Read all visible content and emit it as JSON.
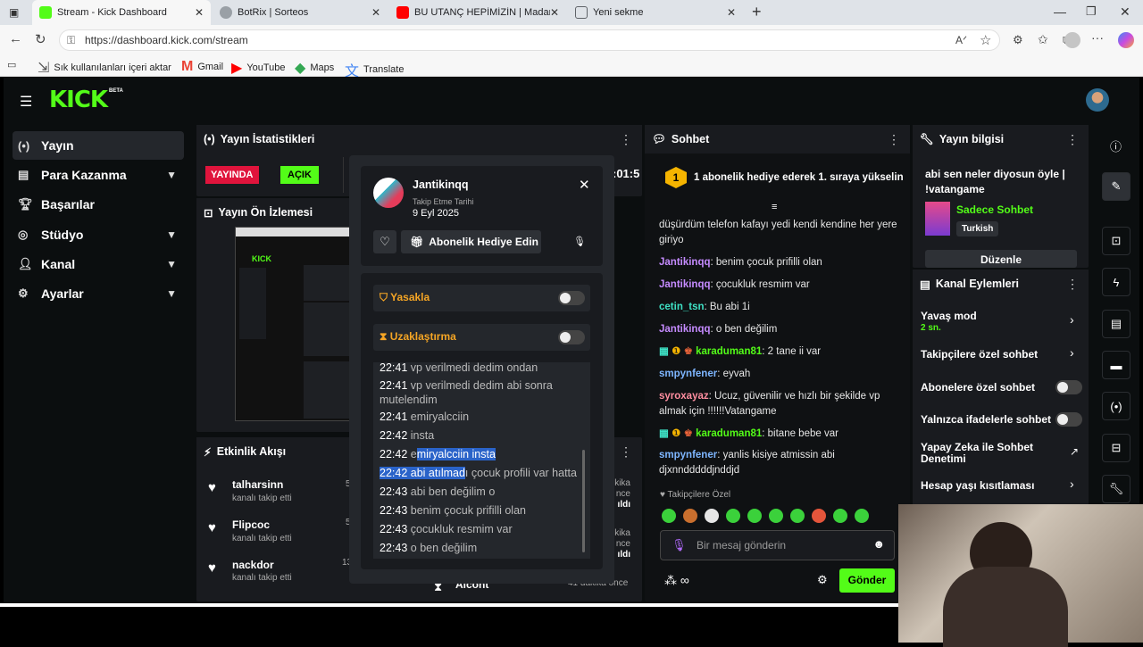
{
  "browser": {
    "tabs": [
      {
        "title": "Stream - Kick Dashboard",
        "favicon_color": "#53fc18"
      },
      {
        "title": "BotRix | Sorteos",
        "favicon_color": "#9aa0a6"
      },
      {
        "title": "BU UTANÇ HEPİMİZİN | Madara C",
        "favicon_color": "#ff0000"
      },
      {
        "title": "Yeni sekme",
        "favicon_color": "#5f6368"
      }
    ],
    "url": "https://dashboard.kick.com/stream",
    "bookmarks": [
      "Sık kullanılanları içeri aktar",
      "Gmail",
      "YouTube",
      "Maps",
      "Translate"
    ]
  },
  "brand": {
    "logo": "KICK",
    "badge": "BETA",
    "accent": "#53fc18"
  },
  "sidebar": {
    "items": [
      {
        "label": "Yayın",
        "icon": "broadcast-icon"
      },
      {
        "label": "Para Kazanma",
        "icon": "wallet-icon"
      },
      {
        "label": "Başarılar",
        "icon": "trophy-icon"
      },
      {
        "label": "Stüdyo",
        "icon": "studio-icon"
      },
      {
        "label": "Kanal",
        "icon": "person-icon"
      },
      {
        "label": "Ayarlar",
        "icon": "gear-icon"
      }
    ]
  },
  "stats": {
    "title": "Yayın İstatistikleri",
    "live_badge": "YAYINDA",
    "open_badge": "AÇIK",
    "timer_fragment": ":01:5"
  },
  "preview": {
    "title": "Yayın Ön İzlemesi"
  },
  "activity": {
    "title": "Etkinlik Akışı",
    "events": [
      {
        "name": "talharsinn",
        "action": "kanalı takip etti"
      },
      {
        "name": "Flipcoc",
        "action": "kanalı takip etti"
      },
      {
        "name": "nackdor",
        "action": "kanalı takip etti"
      }
    ],
    "partial_right": [
      "kika",
      "nce",
      "ıldı"
    ],
    "partial_bottom_name": "Alcont",
    "partial_bottom_time": "41 dakika önce"
  },
  "user_card": {
    "username": "Jantikinqq",
    "follow_label": "Takip Etme Tarihi",
    "follow_date": "9 Eyl 2025",
    "gift_button": "Abonelik Hediye Edin",
    "ban_label": "Yasakla",
    "timeout_label": "Uzaklaştırma",
    "messages": [
      {
        "time": "22:41",
        "text": "vp verilmedi dedim ondan"
      },
      {
        "time": "22:41",
        "text": "vp verilmedi dedim abi sonra mutelendim"
      },
      {
        "time": "22:41",
        "text": "emiryalcciin"
      },
      {
        "time": "22:42",
        "text": "insta"
      },
      {
        "time": "22:42",
        "prefix": "e",
        "highlight": "miryalcciin insta",
        "text": ""
      },
      {
        "time": "22:42",
        "highlight": "abi atılmad",
        "suffix": "ı çocuk profili var hatta"
      },
      {
        "time": "22:43",
        "text": "abi ben değilim o"
      },
      {
        "time": "22:43",
        "text": "benim çocuk prifilli olan"
      },
      {
        "time": "22:43",
        "text": "çocukluk resmim var"
      },
      {
        "time": "22:43",
        "text": "o ben değilim"
      }
    ]
  },
  "chat": {
    "title": "Sohbet",
    "pinned_rank": "1",
    "pinned_text": "1 abonelik hediye ederek 1. sıraya yükselin",
    "messages": [
      {
        "user": "",
        "color": "",
        "text": "düşürdüm telefon kafayı yedi kendi kendine her yere giriyo"
      },
      {
        "user": "Jantikinqq",
        "color": "purple",
        "text": "benim çocuk prifilli olan"
      },
      {
        "user": "Jantikinqq",
        "color": "purple",
        "text": "çocukluk resmim var"
      },
      {
        "user": "cetin_tsn",
        "color": "cyan",
        "text": "Bu abi 1i"
      },
      {
        "user": "Jantikinqq",
        "color": "purple",
        "text": "o ben değilim"
      },
      {
        "user": "karaduman81",
        "color": "green",
        "text": "2 tane ii var",
        "badges": true
      },
      {
        "user": "smpynfener",
        "color": "blue",
        "text": "eyvah"
      },
      {
        "user": "syroxayaz",
        "color": "pink",
        "text": "Ucuz, güvenilir ve hızlı bir şekilde vp almak için !!!!!!Vatangame"
      },
      {
        "user": "karaduman81",
        "color": "green",
        "text": "bitane bebe var",
        "badges": true
      },
      {
        "user": "smpynfener",
        "color": "blue",
        "text": "yanlis kisiye atmissin abi djxnndddddjnddjd"
      }
    ],
    "followers_only": "Takipçilere Özel",
    "input_placeholder": "Bir mesaj gönderin",
    "send_label": "Gönder"
  },
  "stream_info": {
    "title": "Yayın bilgisi",
    "stream_title": "abi sen neler diyosun öyle | !vatangame",
    "category": "Sadece Sohbet",
    "language": "Turkish",
    "edit_label": "Düzenle"
  },
  "channel_actions": {
    "title": "Kanal Eylemleri",
    "items": [
      {
        "label": "Yavaş mod",
        "sub": "2 sn.",
        "control": "chevron"
      },
      {
        "label": "Takipçilere özel sohbet",
        "control": "chevron"
      },
      {
        "label": "Abonelere özel sohbet",
        "control": "toggle"
      },
      {
        "label": "Yalnızca ifadelerle sohbet",
        "control": "toggle"
      },
      {
        "label": "Yapay Zeka ile Sohbet Denetimi",
        "control": "external"
      },
      {
        "label": "Hesap yaşı kısıtlaması",
        "control": "chevron"
      }
    ]
  }
}
